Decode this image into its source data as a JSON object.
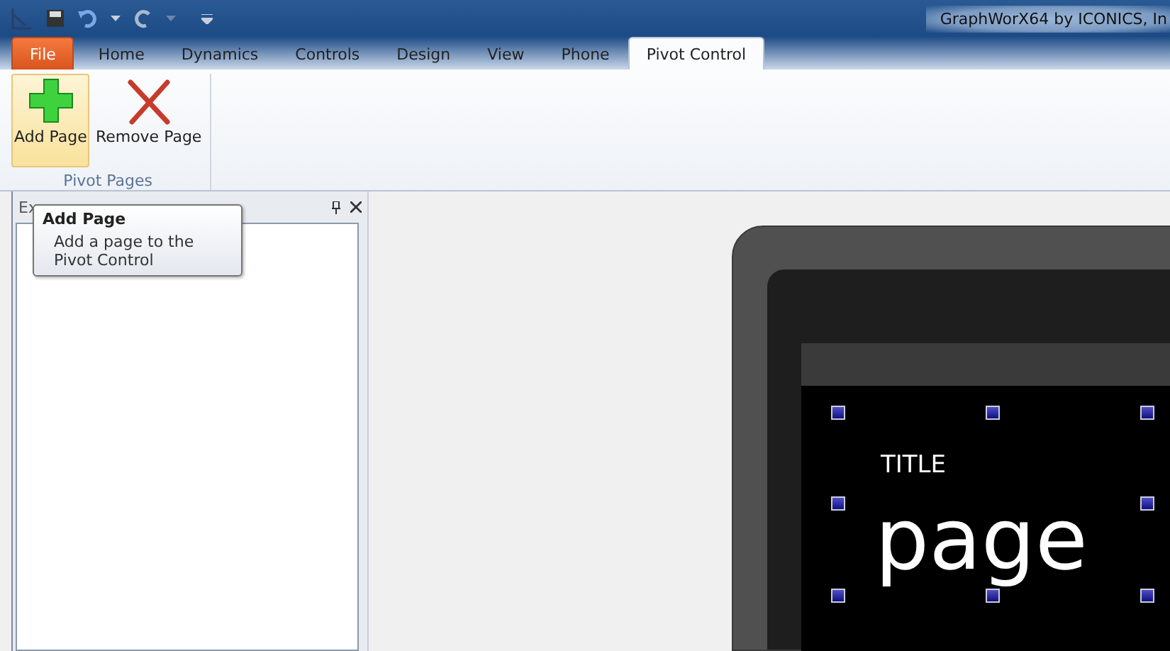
{
  "window": {
    "title": "GraphWorX64 by ICONICS, In"
  },
  "tabs": [
    {
      "label": "File",
      "kind": "file",
      "selected": false
    },
    {
      "label": "Home",
      "kind": "tab",
      "selected": false
    },
    {
      "label": "Dynamics",
      "kind": "tab",
      "selected": false
    },
    {
      "label": "Controls",
      "kind": "tab",
      "selected": false
    },
    {
      "label": "Design",
      "kind": "tab",
      "selected": false
    },
    {
      "label": "View",
      "kind": "tab",
      "selected": false
    },
    {
      "label": "Phone",
      "kind": "tab",
      "selected": false
    },
    {
      "label": "Pivot Control",
      "kind": "tab",
      "selected": true
    }
  ],
  "ribbon": {
    "group": "Pivot Pages",
    "buttons": [
      {
        "label": "Add Page",
        "kind": "add",
        "highlighted": true
      },
      {
        "label": "Remove Page",
        "kind": "remove",
        "highlighted": false
      }
    ]
  },
  "tooltip": {
    "title": "Add Page",
    "text": "Add a page to the Pivot Control"
  },
  "panel": {
    "title": "Ex"
  },
  "canvas": {
    "title": "TITLE",
    "page": "page"
  }
}
